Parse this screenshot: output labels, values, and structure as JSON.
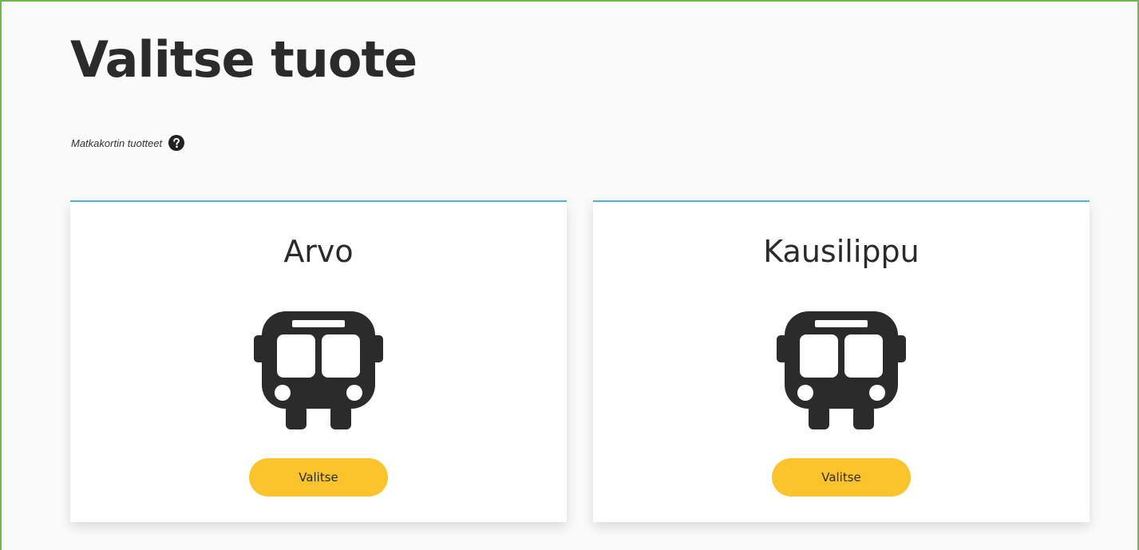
{
  "page": {
    "title": "Valitse tuote",
    "subtitle": "Matkakortin tuotteet",
    "help_icon": "question-circle-icon"
  },
  "colors": {
    "frame_border": "#6cb84c",
    "card_top_border": "#4bb3d8",
    "button": "#fbc32c",
    "text": "#2b2b2b"
  },
  "products": [
    {
      "name": "Arvo",
      "icon": "bus-icon",
      "button_label": "Valitse"
    },
    {
      "name": "Kausilippu",
      "icon": "bus-icon",
      "button_label": "Valitse"
    }
  ]
}
